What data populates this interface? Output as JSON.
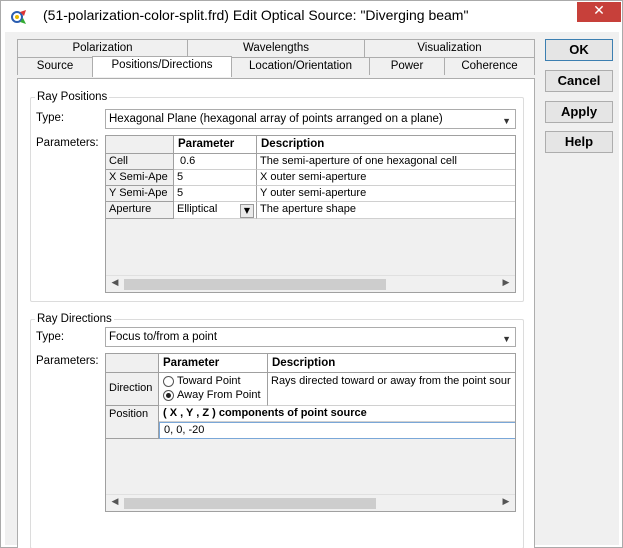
{
  "window": {
    "title": "(51-polarization-color-split.frd) Edit Optical Source: \"Diverging beam\"",
    "close_glyph": "✕"
  },
  "tabs": {
    "row1": [
      "Polarization",
      "Wavelengths",
      "Visualization"
    ],
    "row2": [
      "Source",
      "Positions/Directions",
      "Location/Orientation",
      "Power",
      "Coherence"
    ],
    "active": "Positions/Directions"
  },
  "buttons": {
    "ok": "OK",
    "cancel": "Cancel",
    "apply": "Apply",
    "help": "Help"
  },
  "ray_positions": {
    "group_label": "Ray Positions",
    "type_label": "Type:",
    "type_value": "Hexagonal Plane (hexagonal array of points arranged on a plane)",
    "params_label": "Parameters:",
    "headers": [
      "Parameter",
      "Description"
    ],
    "rows": [
      {
        "name": "Cell",
        "value": "0.6",
        "desc": "The semi-aperture of one hexagonal cell"
      },
      {
        "name": "X Semi-Ape",
        "value": "5",
        "desc": "X outer semi-aperture"
      },
      {
        "name": "Y Semi-Ape",
        "value": "5",
        "desc": "Y outer semi-aperture"
      },
      {
        "name": "Aperture",
        "value": "Elliptical",
        "desc": "The aperture shape"
      }
    ]
  },
  "ray_directions": {
    "group_label": "Ray Directions",
    "type_label": "Type:",
    "type_value": "Focus to/from a point",
    "params_label": "Parameters:",
    "headers": [
      "Parameter",
      "Description"
    ],
    "direction_label": "Direction",
    "radio_options": [
      "Toward Point",
      "Away From Point"
    ],
    "radio_selected": "Away From Point",
    "direction_desc": "Rays directed toward or away from the point sour",
    "position_label": "Position",
    "position_header": "( X , Y , Z ) components of point source",
    "position_value": "0,  0,  -20"
  },
  "icons": {
    "app": "optical-source-icon",
    "close": "close-icon",
    "combo_arrow": "chevron-down-icon"
  }
}
